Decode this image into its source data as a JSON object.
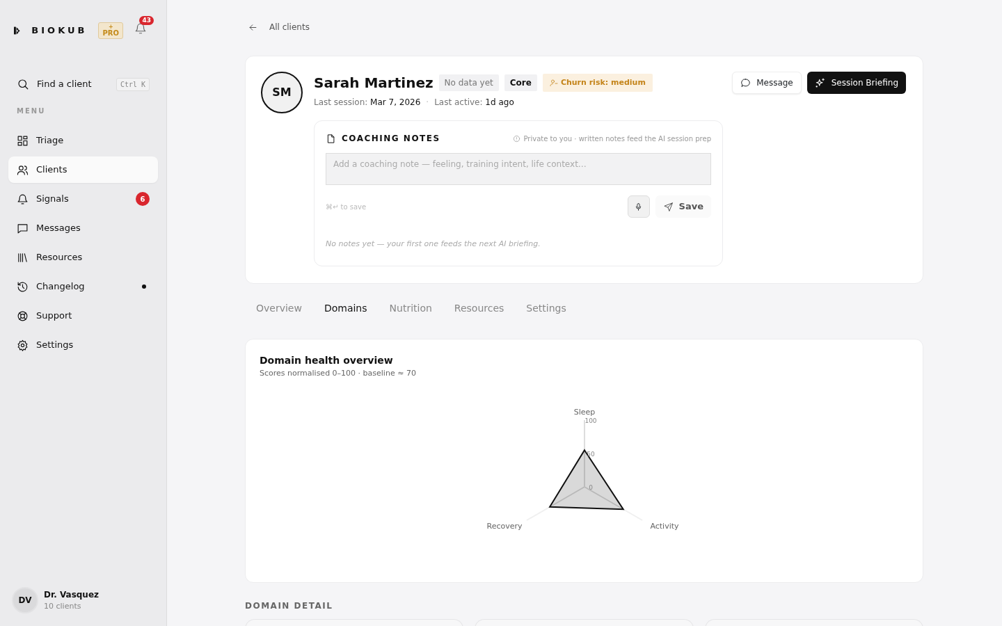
{
  "brand": {
    "name": "BIOKUB",
    "plan_mark": "+",
    "plan": "PRO",
    "notifications": "43"
  },
  "search": {
    "label": "Find a client",
    "shortcut": "Ctrl K"
  },
  "menu_heading": "MENU",
  "sidebar": {
    "items": [
      {
        "label": "Triage",
        "selected": false
      },
      {
        "label": "Clients",
        "selected": true
      },
      {
        "label": "Signals",
        "selected": false,
        "badge": "6"
      },
      {
        "label": "Messages",
        "selected": false
      },
      {
        "label": "Resources",
        "selected": false
      },
      {
        "label": "Changelog",
        "selected": false,
        "dot": true
      },
      {
        "label": "Support",
        "selected": false
      },
      {
        "label": "Settings",
        "selected": false
      }
    ]
  },
  "user": {
    "initials": "DV",
    "name": "Dr. Vasquez",
    "detail": "10 clients"
  },
  "back_link": "All clients",
  "client": {
    "initials": "SM",
    "name": "Sarah Martinez",
    "tags": [
      {
        "kind": "muted",
        "label": "No data yet"
      },
      {
        "kind": "plan",
        "label": "Core"
      },
      {
        "kind": "risk",
        "label": "Churn risk: medium"
      }
    ],
    "meta_separator": "·",
    "meta": [
      {
        "label": "Last session:",
        "value": "Mar 7, 2026"
      },
      {
        "label": "Last active:",
        "value": "1d ago"
      }
    ],
    "actions": [
      {
        "kind": "secondary",
        "label": "Message"
      },
      {
        "kind": "primary",
        "label": "Session Briefing"
      }
    ]
  },
  "notes": {
    "title": "COACHING NOTES",
    "privacy": "Private to you · written notes feed the AI session prep",
    "placeholder": "Add a coaching note — feeling, training intent, life context…",
    "hint": "⌘↵ to save",
    "save": "Save",
    "empty": "No notes yet — your first one feeds the next AI briefing."
  },
  "tabs": [
    {
      "label": "Overview",
      "selected": false
    },
    {
      "label": "Domains",
      "selected": true
    },
    {
      "label": "Nutrition",
      "selected": false
    },
    {
      "label": "Resources",
      "selected": false
    },
    {
      "label": "Settings",
      "selected": false
    }
  ],
  "overview": {
    "title": "Domain health overview",
    "subtitle": "Scores normalised 0–100 · baseline ≈ 70",
    "radar": {
      "axes": [
        {
          "label": "Sleep",
          "level": 0.55
        },
        {
          "label": "Activity",
          "level": 0.67
        },
        {
          "label": "Recovery",
          "level": 0.6
        }
      ],
      "scale": [
        "100",
        "50",
        "0"
      ]
    }
  },
  "detail_heading": "DOMAIN DETAIL"
}
